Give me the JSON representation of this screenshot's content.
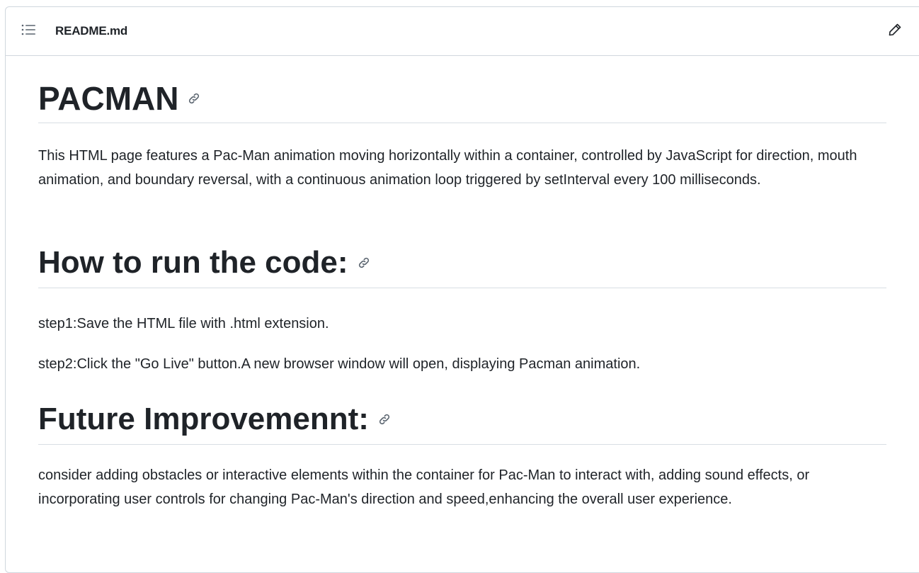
{
  "header": {
    "file_name": "README.md",
    "outline_icon": "list-unordered-icon",
    "edit_icon": "pencil-icon"
  },
  "content": {
    "h1_title": "PACMAN",
    "intro": "This HTML page features a Pac-Man animation moving horizontally within a container, controlled by JavaScript for direction, mouth animation, and boundary reversal, with a continuous animation loop triggered by setInterval every 100 milliseconds.",
    "h1_run": "How to run the code:",
    "step1": "step1:Save the HTML file with .html extension.",
    "step2": "step2:Click the \"Go Live\" button.A new browser window will open, displaying Pacman animation.",
    "h1_future": "Future Improvemennt:",
    "future_text": "consider adding obstacles or interactive elements within the container for Pac-Man to interact with, adding sound effects, or incorporating user controls for changing Pac-Man's direction and speed,enhancing the overall user experience.",
    "anchor_icon": "link-icon"
  },
  "colors": {
    "text": "#1f2328",
    "muted_icon": "#59636e",
    "border": "#d0d7de"
  }
}
